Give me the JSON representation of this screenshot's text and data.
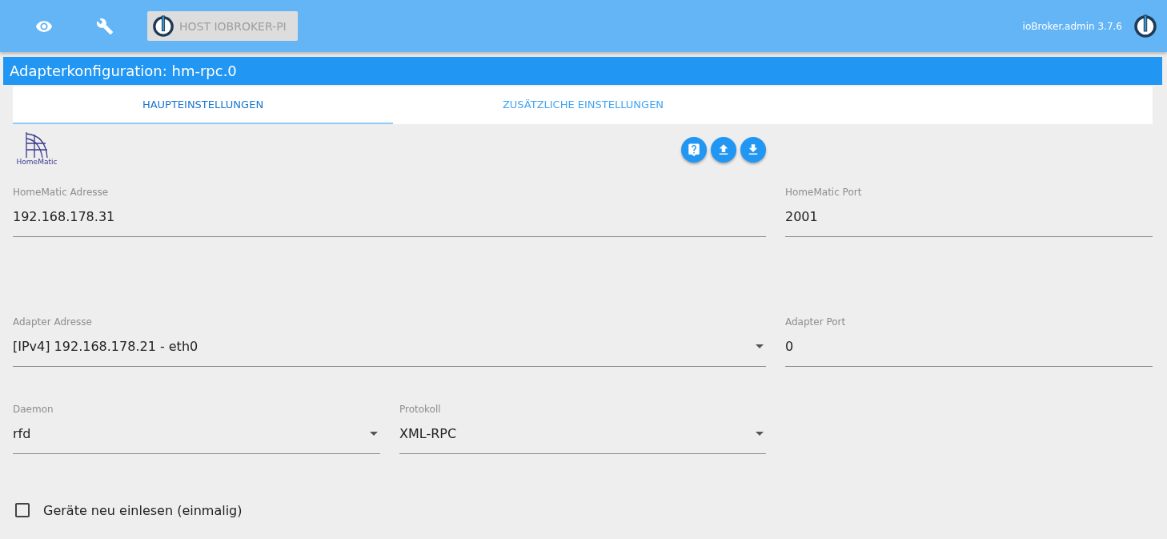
{
  "header": {
    "host_button": "HOST IOBROKER-PI",
    "version": "ioBroker.admin 3.7.6"
  },
  "title": "Adapterkonfiguration: hm-rpc.0",
  "tabs": [
    {
      "label": "HAUPTEINSTELLUNGEN",
      "selected": true
    },
    {
      "label": "ZUSÄTZLICHE EINSTELLUNGEN",
      "selected": false
    }
  ],
  "logo_text": "HomeMatic",
  "rows": [
    {
      "fields": [
        {
          "kind": "text",
          "label": "HomeMatic Adresse",
          "value": "192.168.178.31"
        },
        {
          "kind": "text",
          "label": "HomeMatic Port",
          "value": "2001"
        }
      ]
    },
    {
      "fields": [
        {
          "kind": "select",
          "label": "Adapter Adresse",
          "value": "[IPv4] 192.168.178.21 - eth0"
        },
        {
          "kind": "text",
          "label": "Adapter Port",
          "value": "0"
        }
      ]
    },
    {
      "fields": [
        {
          "kind": "select",
          "label": "Daemon",
          "value": "rfd"
        },
        {
          "kind": "select",
          "label": "Protokoll",
          "value": "XML-RPC"
        }
      ]
    }
  ],
  "checkbox": {
    "label": "Geräte neu einlesen (einmalig)",
    "checked": false
  }
}
